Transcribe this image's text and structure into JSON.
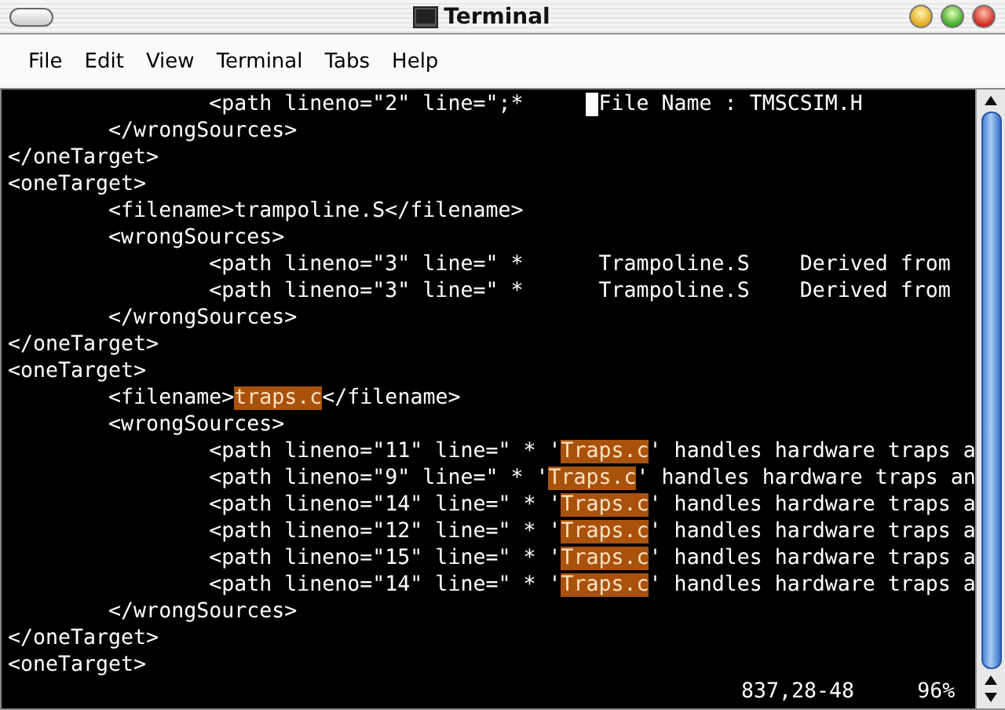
{
  "window": {
    "title": "Terminal"
  },
  "menu": [
    {
      "label": "File"
    },
    {
      "label": "Edit"
    },
    {
      "label": "View"
    },
    {
      "label": "Terminal"
    },
    {
      "label": "Tabs"
    },
    {
      "label": "Help"
    }
  ],
  "terminal": {
    "lines": [
      [
        {
          "kind": "plain",
          "text": "                <path lineno=\"2\" line=\";*     "
        },
        {
          "kind": "plain",
          "cursor": true,
          "text": "File Name : TMSCSIM.H"
        }
      ],
      [
        {
          "kind": "plain",
          "text": "        </wrongSources>"
        }
      ],
      [
        {
          "kind": "plain",
          "text": "</oneTarget>"
        }
      ],
      [
        {
          "kind": "plain",
          "text": "<oneTarget>"
        }
      ],
      [
        {
          "kind": "plain",
          "text": "        <filename>trampoline.S</filename>"
        }
      ],
      [
        {
          "kind": "plain",
          "text": "        <wrongSources>"
        }
      ],
      [
        {
          "kind": "plain",
          "text": "                <path lineno=\"3\" line=\" *      Trampoline.S    Derived from"
        }
      ],
      [
        {
          "kind": "plain",
          "text": "                <path lineno=\"3\" line=\" *      Trampoline.S    Derived from"
        }
      ],
      [
        {
          "kind": "plain",
          "text": "        </wrongSources>"
        }
      ],
      [
        {
          "kind": "plain",
          "text": "</oneTarget>"
        }
      ],
      [
        {
          "kind": "plain",
          "text": "<oneTarget>"
        }
      ],
      [
        {
          "kind": "plain",
          "text": "        <filename>"
        },
        {
          "kind": "match",
          "text": "traps.c"
        },
        {
          "kind": "plain",
          "text": "</filename>"
        }
      ],
      [
        {
          "kind": "plain",
          "text": "        <wrongSources>"
        }
      ],
      [
        {
          "kind": "plain",
          "text": "                <path lineno=\"11\" line=\" * '"
        },
        {
          "kind": "match",
          "text": "Traps.c"
        },
        {
          "kind": "plain",
          "text": "' handles hardware traps a"
        }
      ],
      [
        {
          "kind": "plain",
          "text": "                <path lineno=\"9\" line=\" * '"
        },
        {
          "kind": "match",
          "text": "Traps.c"
        },
        {
          "kind": "plain",
          "text": "' handles hardware traps an"
        }
      ],
      [
        {
          "kind": "plain",
          "text": "                <path lineno=\"14\" line=\" * '"
        },
        {
          "kind": "match",
          "text": "Traps.c"
        },
        {
          "kind": "plain",
          "text": "' handles hardware traps a"
        }
      ],
      [
        {
          "kind": "plain",
          "text": "                <path lineno=\"12\" line=\" * '"
        },
        {
          "kind": "match",
          "text": "Traps.c"
        },
        {
          "kind": "plain",
          "text": "' handles hardware traps a"
        }
      ],
      [
        {
          "kind": "plain",
          "text": "                <path lineno=\"15\" line=\" * '"
        },
        {
          "kind": "match",
          "text": "Traps.c"
        },
        {
          "kind": "plain",
          "text": "' handles hardware traps a"
        }
      ],
      [
        {
          "kind": "plain",
          "text": "                <path lineno=\"14\" line=\" * '"
        },
        {
          "kind": "match",
          "text": "Traps.c"
        },
        {
          "kind": "plain",
          "text": "' handles hardware traps a"
        }
      ],
      [
        {
          "kind": "plain",
          "text": "        </wrongSources>"
        }
      ],
      [
        {
          "kind": "plain",
          "text": "</oneTarget>"
        }
      ],
      [
        {
          "kind": "plain",
          "text": "<oneTarget>"
        }
      ]
    ],
    "status": {
      "position": "837,28-48",
      "percent": "96%"
    }
  }
}
